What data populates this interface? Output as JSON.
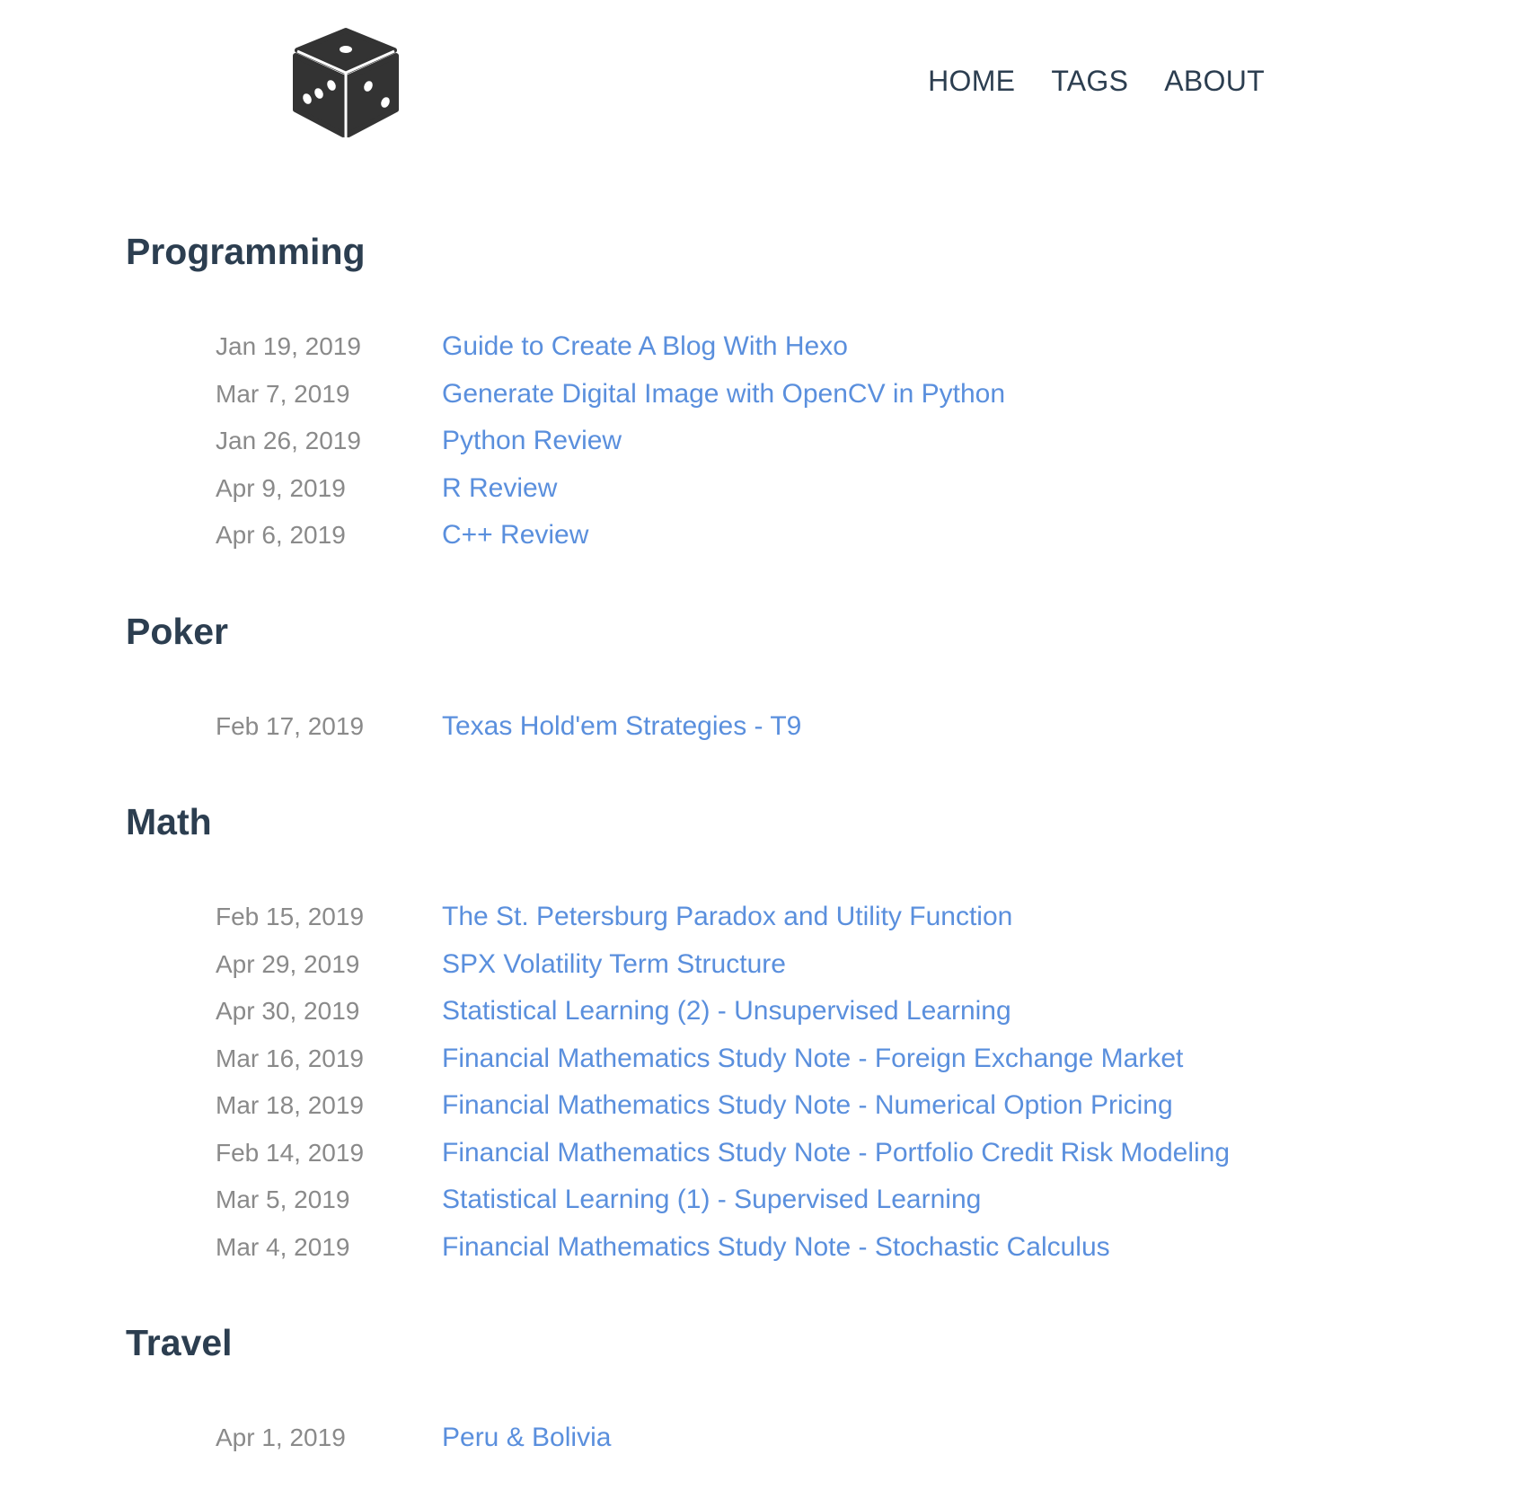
{
  "header": {
    "logo_icon": "dice-icon",
    "nav": [
      {
        "label": "HOME"
      },
      {
        "label": "TAGS"
      },
      {
        "label": "ABOUT"
      }
    ]
  },
  "categories": [
    {
      "title": "Programming",
      "posts": [
        {
          "date": "Jan 19, 2019",
          "title": "Guide to Create A Blog With Hexo"
        },
        {
          "date": "Mar 7, 2019",
          "title": "Generate Digital Image with OpenCV in Python"
        },
        {
          "date": "Jan 26, 2019",
          "title": "Python Review"
        },
        {
          "date": "Apr 9, 2019",
          "title": "R Review"
        },
        {
          "date": "Apr 6, 2019",
          "title": "C++ Review"
        }
      ]
    },
    {
      "title": "Poker",
      "posts": [
        {
          "date": "Feb 17, 2019",
          "title": "Texas Hold'em Strategies - T9"
        }
      ]
    },
    {
      "title": "Math",
      "posts": [
        {
          "date": "Feb 15, 2019",
          "title": "The St. Petersburg Paradox and Utility Function"
        },
        {
          "date": "Apr 29, 2019",
          "title": "SPX Volatility Term Structure"
        },
        {
          "date": "Apr 30, 2019",
          "title": "Statistical Learning (2) - Unsupervised Learning"
        },
        {
          "date": "Mar 16, 2019",
          "title": "Financial Mathematics Study Note - Foreign Exchange Market"
        },
        {
          "date": "Mar 18, 2019",
          "title": "Financial Mathematics Study Note - Numerical Option Pricing"
        },
        {
          "date": "Feb 14, 2019",
          "title": "Financial Mathematics Study Note - Portfolio Credit Risk Modeling"
        },
        {
          "date": "Mar 5, 2019",
          "title": "Statistical Learning (1) - Supervised Learning"
        },
        {
          "date": "Mar 4, 2019",
          "title": "Financial Mathematics Study Note - Stochastic Calculus"
        }
      ]
    },
    {
      "title": "Travel",
      "posts": [
        {
          "date": "Apr 1, 2019",
          "title": "Peru & Bolivia"
        }
      ]
    }
  ],
  "colors": {
    "heading": "#2c3e50",
    "date": "#8a8a8a",
    "link": "#5a8fdd",
    "logo": "#333333"
  }
}
